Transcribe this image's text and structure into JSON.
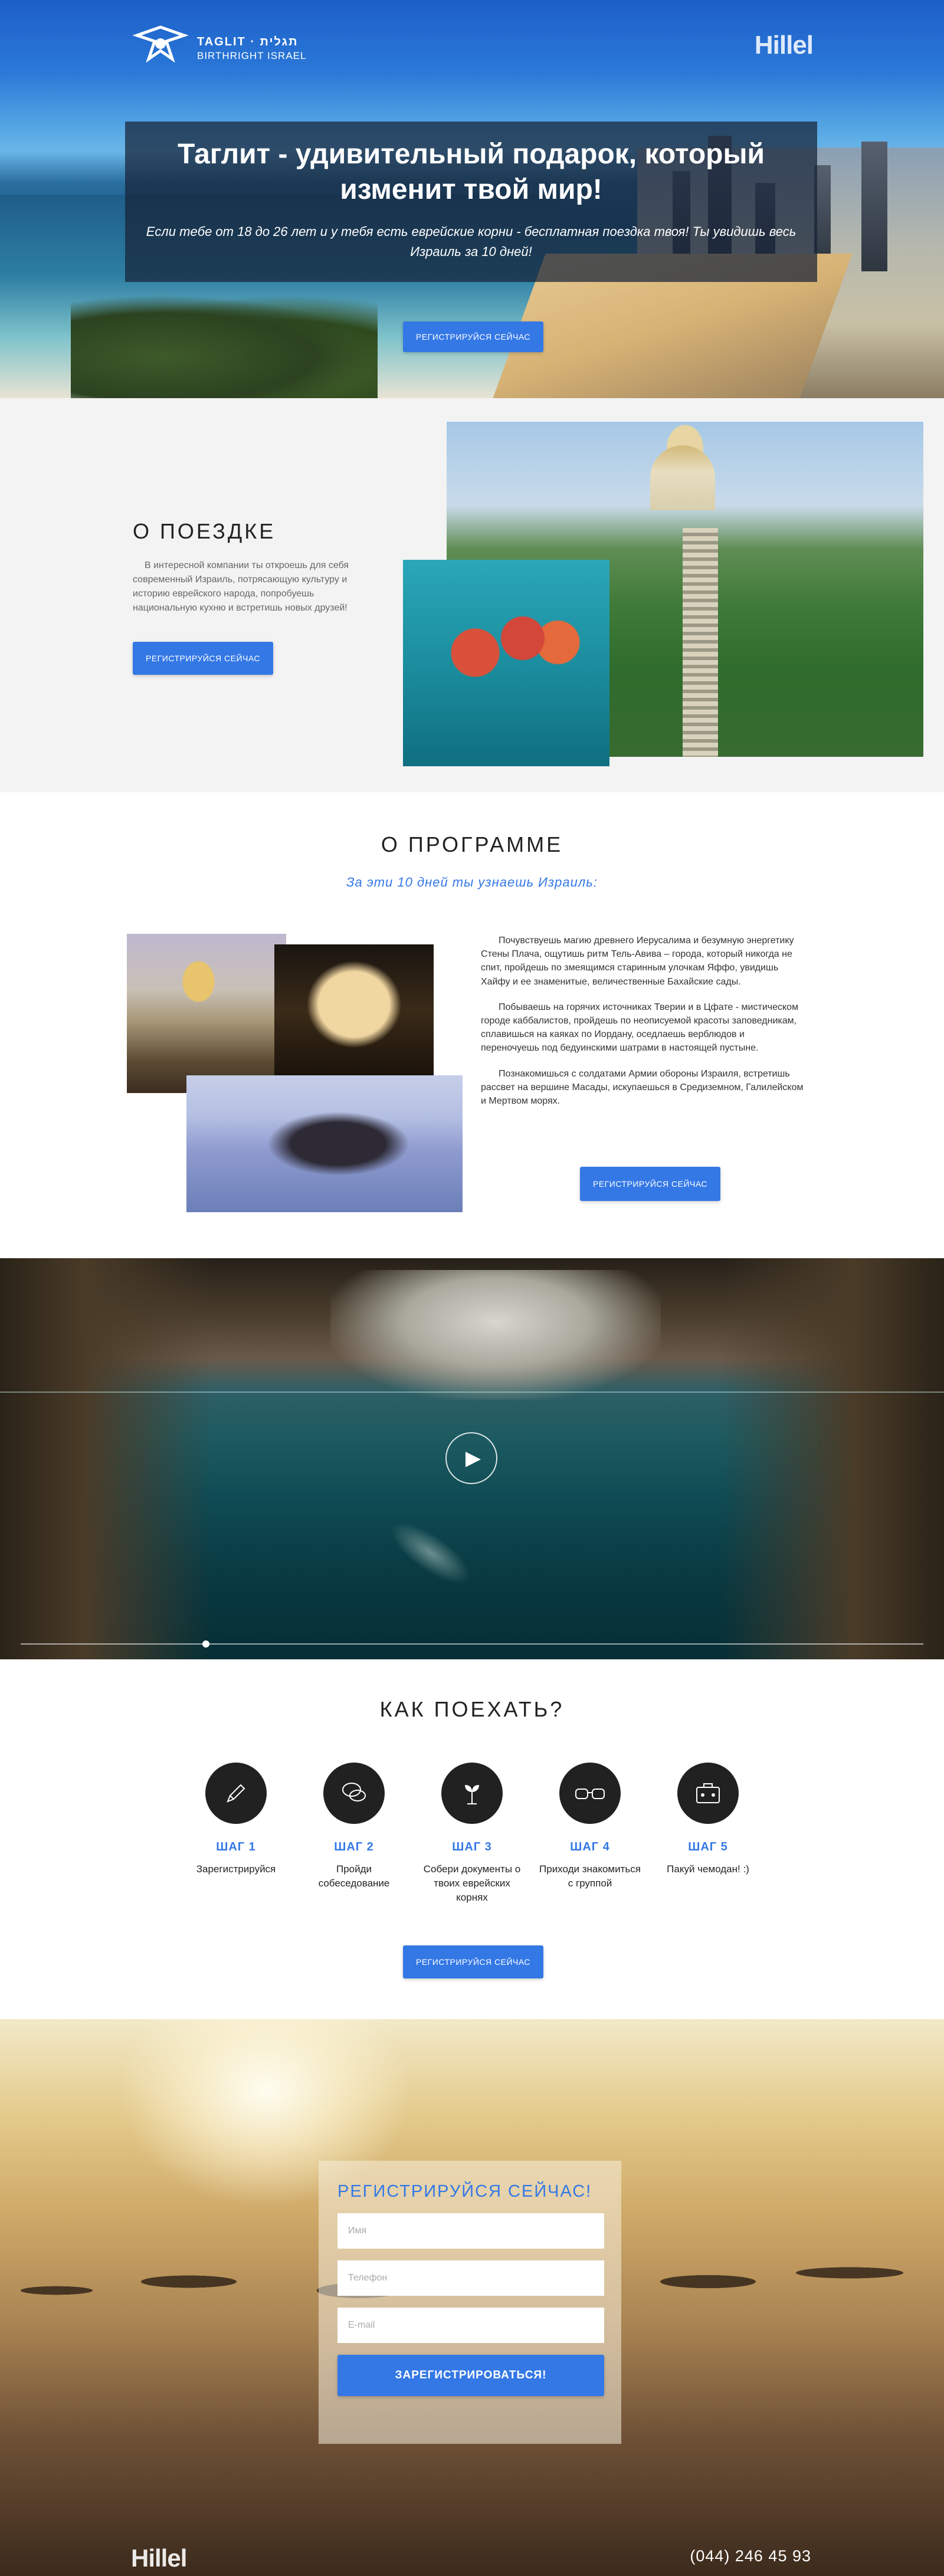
{
  "header": {
    "logo_line1": "TAGLIT · תגלית",
    "logo_line2": "BIRTHRIGHT ISRAEL",
    "partner_logo": "Hillel"
  },
  "hero": {
    "title": "Таглит - удивительный подарок, который изменит твой мир!",
    "subtitle": "Если тебе от 18 до 26 лет и у тебя есть еврейские корни - бесплатная поездка твоя! Ты увидишь весь Израиль за 10 дней!",
    "cta": "Регистрируйся сейчас"
  },
  "about": {
    "title": "О ПОЕЗДКЕ",
    "text": "В интересной компании ты откроешь для себя современный Израиль, потрясающую культуру и историю еврейского народа, попробуешь национальную кухню и встретишь новых друзей!",
    "cta": "Регистрируйся сейчас"
  },
  "program": {
    "title": "О ПРОГРАММЕ",
    "subtitle": "За эти 10 дней ты узнаешь Израиль:",
    "p1": "Почувствуешь магию древнего Иерусалима и безумную энергетику Стены Плача, ощутишь ритм Тель-Авива – города, который никогда не спит, пройдешь по змеящимся старинным улочкам Яффо, увидишь Хайфу и ее знаменитые, величественные Бахайские сады.",
    "p2": "Побываешь на горячих источниках Тверии и в Цфате - мистическом городе каббалистов, пройдешь по неописуемой красоты заповедникам, сплавишься на каяках по Иордану, оседлаешь верблюдов и переночуешь под бедуинскими шатрами в настоящей пустыне.",
    "p3": "Познакомишься с солдатами Армии обороны Израиля, встретишь рассвет на вершине Масады, искупаешься в Средиземном, Галилейском и Мертвом морях.",
    "cta": "Регистрируйся сейчас"
  },
  "video": {
    "play_icon": "play-icon",
    "progress": 0.205
  },
  "how": {
    "title": "КАК ПОЕХАТЬ?",
    "steps": [
      {
        "num": "ШАГ 1",
        "text": "Зарегистрируйся",
        "icon": "pencil-icon"
      },
      {
        "num": "ШАГ 2",
        "text": "Пройди собеседование",
        "icon": "chat-icon"
      },
      {
        "num": "ШАГ 3",
        "text": "Собери документы о твоих еврейских корнях",
        "icon": "sprout-icon"
      },
      {
        "num": "ШАГ 4",
        "text": "Приходи знакомиться с группой",
        "icon": "glasses-icon"
      },
      {
        "num": "ШАГ 5",
        "text": "Пакуй чемодан! :)",
        "icon": "suitcase-icon"
      }
    ],
    "cta": "Регистрируйся сейчас"
  },
  "register": {
    "title": "РЕГИСТРИРУЙСЯ СЕЙЧАС!",
    "name_placeholder": "Имя",
    "phone_placeholder": "Телефон",
    "email_placeholder": "E-mail",
    "submit": "Зарегистрироваться!"
  },
  "footer": {
    "logo": "Hillel",
    "phone": "(044) 246 45 93"
  },
  "colors": {
    "accent": "#3478e6",
    "dark": "#212121"
  }
}
